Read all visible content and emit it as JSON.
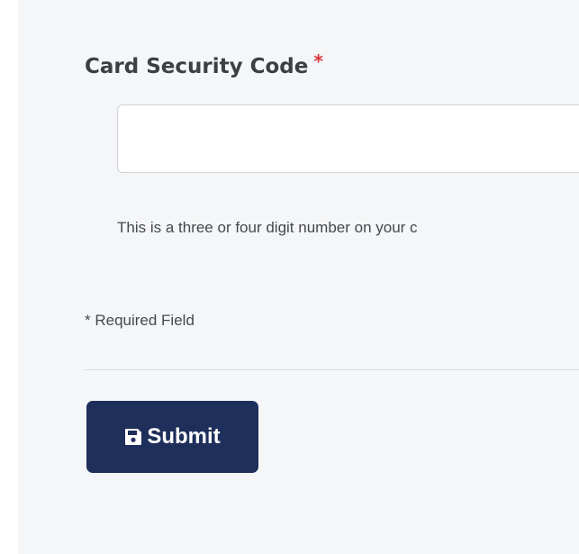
{
  "form": {
    "field_label": "Card Security Code",
    "required_marker": "*",
    "input_value": "",
    "input_placeholder": "",
    "help_text": "This is a three or four digit number on your c",
    "required_note": "* Required Field",
    "submit_label": "Submit",
    "submit_icon": "save-icon"
  },
  "colors": {
    "required": "#d8353b",
    "button_bg": "#1f2f5b",
    "panel_bg": "#f5f6f8"
  }
}
